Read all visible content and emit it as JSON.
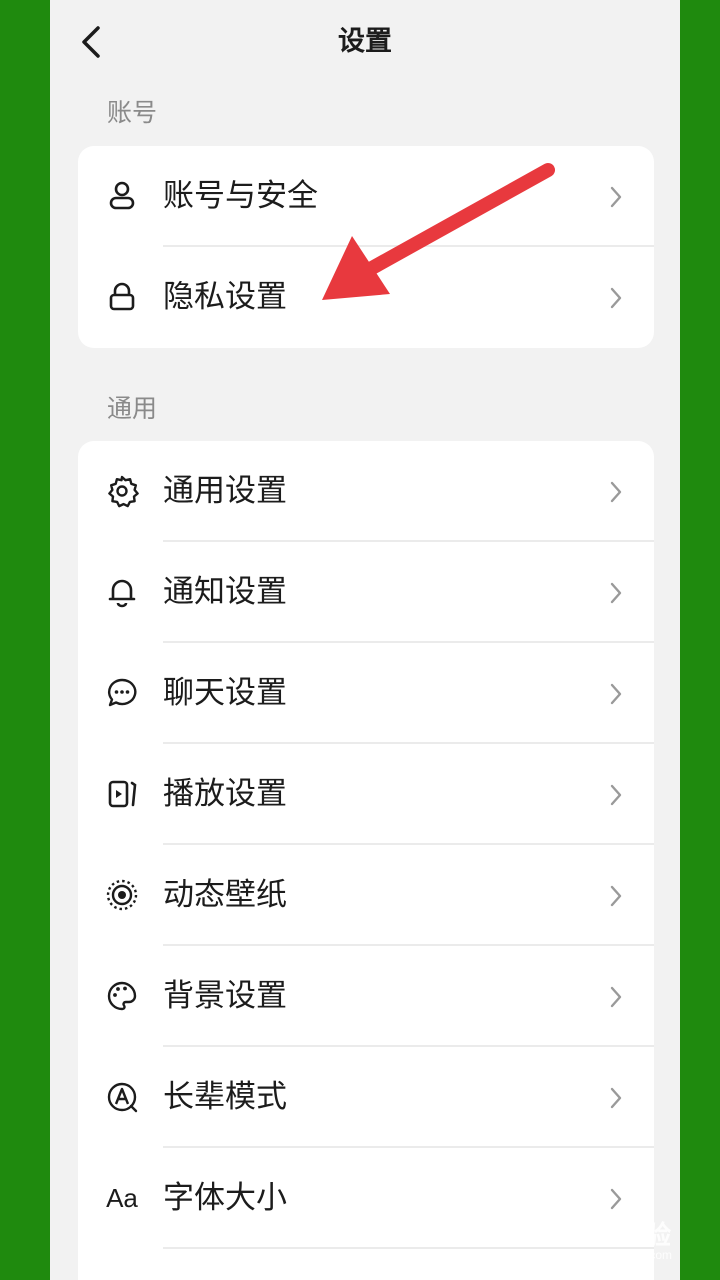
{
  "header": {
    "title": "设置",
    "back_icon": "chevron-left-icon"
  },
  "sections": [
    {
      "label": "账号",
      "items": [
        {
          "label": "账号与安全",
          "icon": "user-icon"
        },
        {
          "label": "隐私设置",
          "icon": "lock-icon"
        }
      ]
    },
    {
      "label": "通用",
      "items": [
        {
          "label": "通用设置",
          "icon": "gear-icon"
        },
        {
          "label": "通知设置",
          "icon": "bell-icon"
        },
        {
          "label": "聊天设置",
          "icon": "chat-bubble-icon"
        },
        {
          "label": "播放设置",
          "icon": "play-icon"
        },
        {
          "label": "动态壁纸",
          "icon": "live-wallpaper-icon"
        },
        {
          "label": "背景设置",
          "icon": "palette-icon"
        },
        {
          "label": "长辈模式",
          "icon": "elder-mode-icon"
        },
        {
          "label": "字体大小",
          "icon": "font-size-icon",
          "icon_text": "Aa"
        }
      ]
    }
  ],
  "annotation": {
    "arrow_color": "#e8393e",
    "points_to": "隐私设置"
  },
  "watermark": {
    "main": "Bai经验",
    "sub": "jingyan.baidu.com"
  },
  "colors": {
    "frame": "#1f8a0e",
    "background": "#f2f2f2",
    "card": "#ffffff",
    "text": "#1c1c1c",
    "section_label": "#8a8a8a"
  }
}
